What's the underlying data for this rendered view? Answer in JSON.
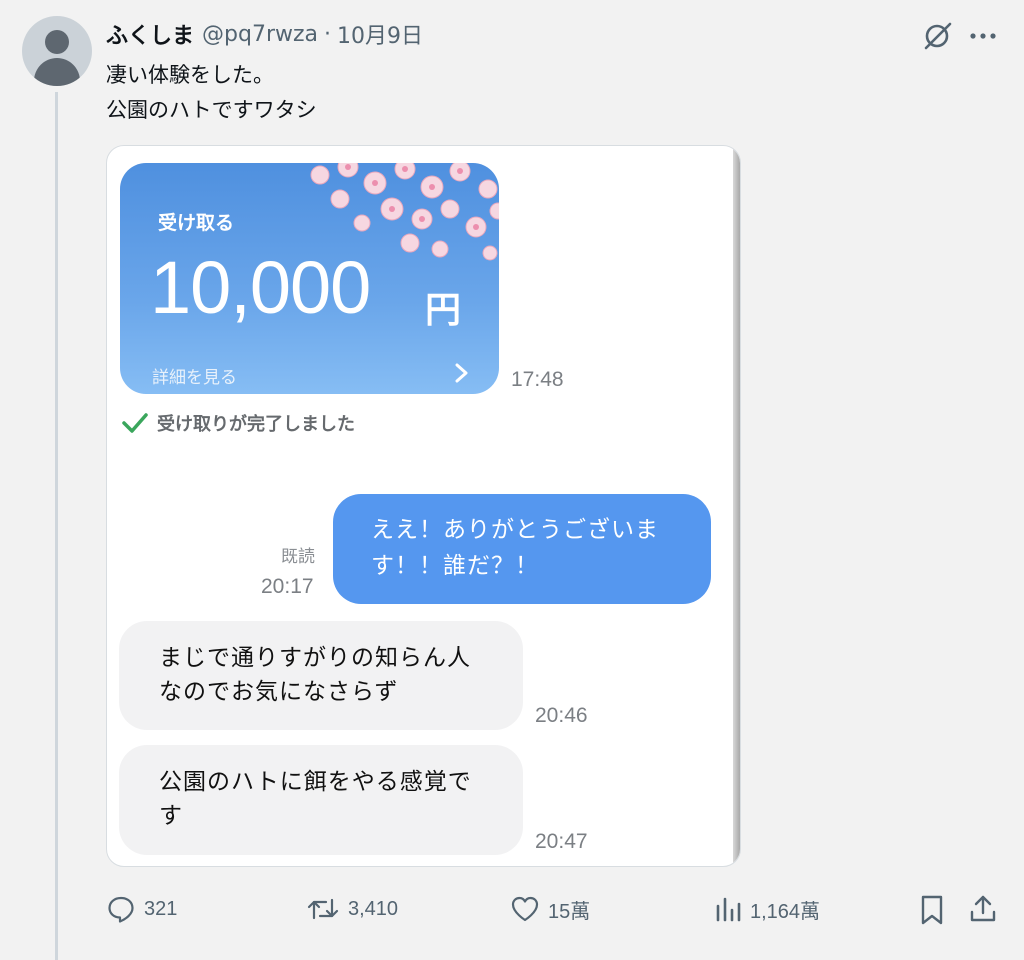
{
  "tweet": {
    "author_name": "ふくしま",
    "handle": "@pq7rwza",
    "separator": "·",
    "date": "10月9日",
    "text_lines": [
      "凄い体験をした。",
      "公園のハトですワタシ"
    ]
  },
  "chat": {
    "gift_card": {
      "receive_label": "受け取る",
      "amount": "10,000",
      "currency": "円",
      "details_label": "詳細を見る"
    },
    "gift_time": "17:48",
    "received_status": "受け取りが完了しました",
    "outgoing": {
      "read_label": "既読",
      "time": "20:17",
      "lines": [
        "ええ！ありがとうございま",
        "す！！誰だ？！"
      ]
    },
    "incoming": [
      {
        "lines": [
          "まじで通りすがりの知らん人",
          "なのでお気になさらず"
        ],
        "time": "20:46"
      },
      {
        "lines": [
          "公園のハトに餌をやる感覚で",
          "す"
        ],
        "time": "20:47"
      }
    ]
  },
  "actions": {
    "replies": "321",
    "reposts": "3,410",
    "likes": "15萬",
    "views": "1,164萬"
  },
  "icons": {
    "reply": "comment-icon",
    "repost": "repost-icon",
    "like": "heart-icon",
    "views": "views-chart-icon",
    "bookmark": "bookmark-icon",
    "share": "share-icon",
    "grok": "grok-icon",
    "more": "more-icon",
    "check": "check-icon"
  },
  "colors": {
    "accent_blue": "#5597ef",
    "check_green": "#3aa65c",
    "secondary_text": "#536471"
  }
}
